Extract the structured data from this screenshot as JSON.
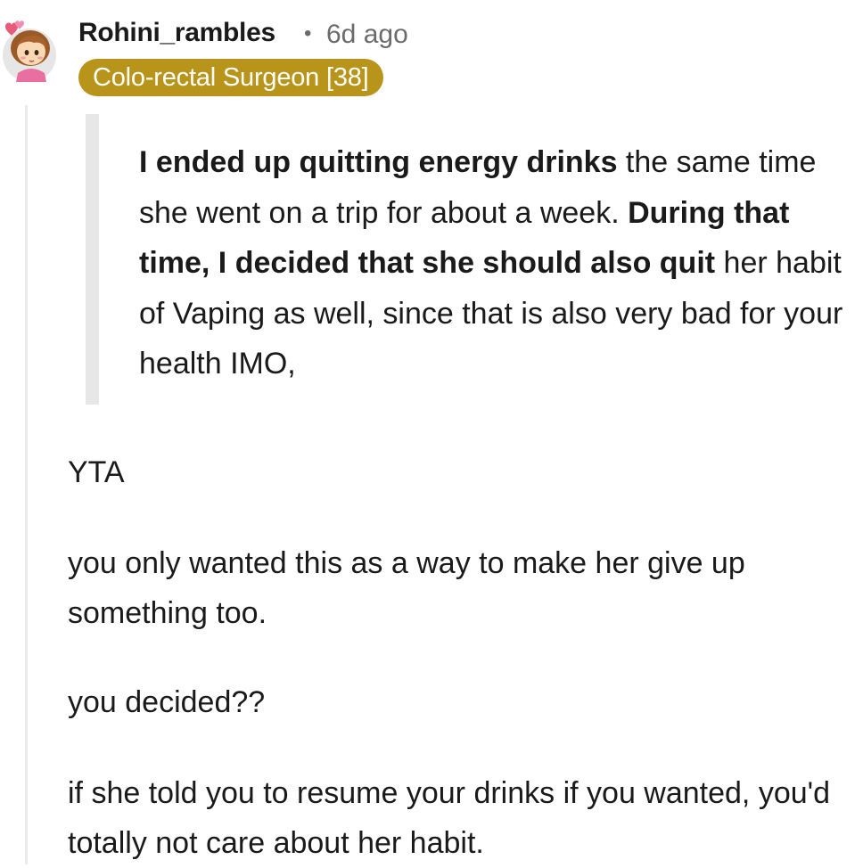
{
  "comment": {
    "author": "Rohini_rambles",
    "separator": "•",
    "time_ago": "6d ago",
    "flair": "Colo-rectal Surgeon [38]",
    "quote": {
      "segments": [
        {
          "text": "I ended up quitting energy drinks",
          "bold": true
        },
        {
          "text": " the same time she went on a trip for about a week. ",
          "bold": false
        },
        {
          "text": "During that time, I decided that she should also quit",
          "bold": true
        },
        {
          "text": " her habit of Vaping as well, since that is also very bad for your health IMO,",
          "bold": false
        }
      ]
    },
    "paragraphs": [
      "YTA",
      "you only wanted this as a way to make her give up something too.",
      "you decided??",
      "if she told you to resume your drinks if you wanted, you'd totally not care about her habit."
    ]
  }
}
